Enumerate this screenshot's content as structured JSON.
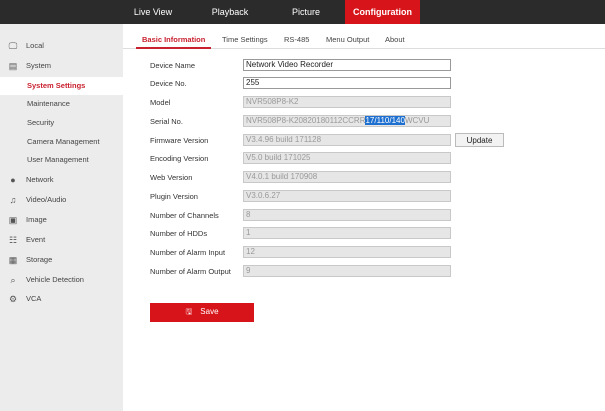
{
  "top_nav": [
    "Live View",
    "Playback",
    "Picture",
    "Configuration"
  ],
  "sidebar": [
    {
      "label": "Local",
      "icon": "monitor-icon"
    },
    {
      "label": "System",
      "icon": "system-icon"
    },
    {
      "label": "System Settings"
    },
    {
      "label": "Maintenance"
    },
    {
      "label": "Security"
    },
    {
      "label": "Camera Management"
    },
    {
      "label": "User Management"
    },
    {
      "label": "Network",
      "icon": "globe-icon"
    },
    {
      "label": "Video/Audio",
      "icon": "video-audio-icon"
    },
    {
      "label": "Image",
      "icon": "image-icon"
    },
    {
      "label": "Event",
      "icon": "event-icon"
    },
    {
      "label": "Storage",
      "icon": "storage-icon"
    },
    {
      "label": "Vehicle Detection",
      "icon": "vehicle-detection-icon"
    },
    {
      "label": "VCA",
      "icon": "vca-icon"
    }
  ],
  "tabs": [
    "Basic Information",
    "Time Settings",
    "RS-485",
    "Menu Output",
    "About"
  ],
  "form": {
    "device_name": {
      "label": "Device Name",
      "value": "Network Video Recorder"
    },
    "device_no": {
      "label": "Device No.",
      "value": "255"
    },
    "model": {
      "label": "Model",
      "value": "NVR508P8-K2"
    },
    "serial": {
      "label": "Serial No.",
      "value_a": "NVR508P8-K20820180112CCRR",
      "value_sel": "17/110/140",
      "value_b": "WCVU"
    },
    "firmware": {
      "label": "Firmware Version",
      "value": "V3.4.96 build 171128"
    },
    "encoding": {
      "label": "Encoding Version",
      "value": "V5.0 build 171025"
    },
    "web": {
      "label": "Web Version",
      "value": "V4.0.1 build 170908"
    },
    "plugin": {
      "label": "Plugin Version",
      "value": "V3.0.6.27"
    },
    "channels": {
      "label": "Number of Channels",
      "value": "8"
    },
    "hdds": {
      "label": "Number of HDDs",
      "value": "1"
    },
    "alarm_in": {
      "label": "Number of Alarm Input",
      "value": "12"
    },
    "alarm_out": {
      "label": "Number of Alarm Output",
      "value": "9"
    }
  },
  "update_label": "Update",
  "save_label": "Save"
}
